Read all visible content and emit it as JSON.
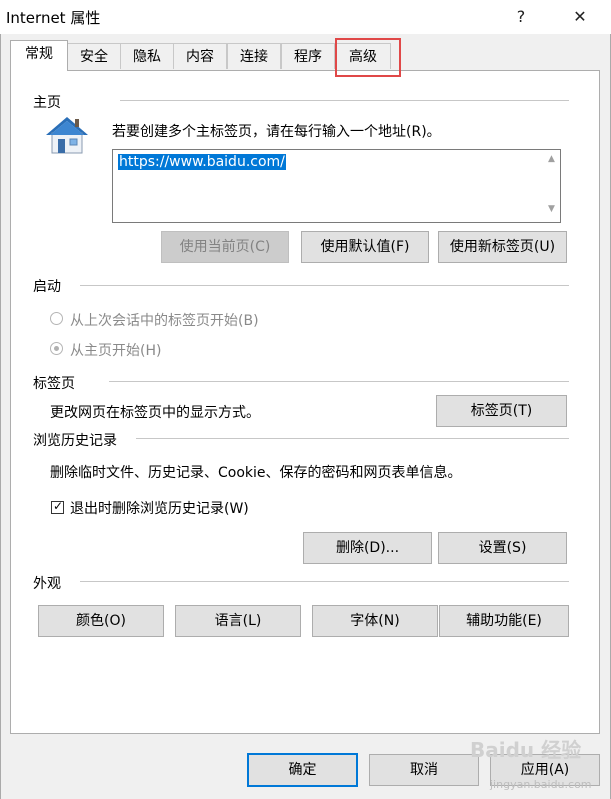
{
  "window": {
    "title": "Internet 属性",
    "help_glyph": "?",
    "close_glyph": "✕"
  },
  "tabs": [
    {
      "label": "常规",
      "active": true
    },
    {
      "label": "安全"
    },
    {
      "label": "隐私"
    },
    {
      "label": "内容"
    },
    {
      "label": "连接"
    },
    {
      "label": "程序"
    },
    {
      "label": "高级",
      "highlighted": true
    }
  ],
  "homepage": {
    "section_label": "主页",
    "instruction": "若要创建多个主标签页，请在每行输入一个地址(R)。",
    "url_value": "https://www.baidu.com/",
    "use_current_label": "使用当前页(C)",
    "use_default_label": "使用默认值(F)",
    "use_new_tab_label": "使用新标签页(U)"
  },
  "startup": {
    "section_label": "启动",
    "option_last_session": "从上次会话中的标签页开始(B)",
    "option_homepage": "从主页开始(H)",
    "selected": "option_homepage"
  },
  "tabs_section": {
    "section_label": "标签页",
    "description": "更改网页在标签页中的显示方式。",
    "button_label": "标签页(T)"
  },
  "history": {
    "section_label": "浏览历史记录",
    "description": "删除临时文件、历史记录、Cookie、保存的密码和网页表单信息。",
    "delete_on_exit_label": "退出时删除浏览历史记录(W)",
    "delete_on_exit_checked": true,
    "delete_button": "删除(D)...",
    "settings_button": "设置(S)"
  },
  "appearance": {
    "section_label": "外观",
    "colors_button": "颜色(O)",
    "languages_button": "语言(L)",
    "fonts_button": "字体(N)",
    "accessibility_button": "辅助功能(E)"
  },
  "footer": {
    "ok_button": "确定",
    "cancel_button": "取消",
    "apply_button": "应用(A)"
  },
  "watermark": {
    "text": "Baidu 经验",
    "url": "jingyan.baidu.com"
  }
}
